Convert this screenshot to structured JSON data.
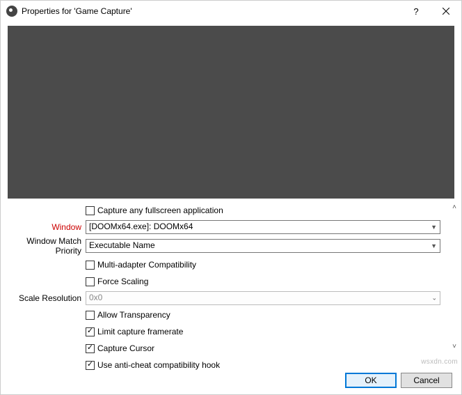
{
  "titlebar": {
    "title": "Properties for 'Game Capture'"
  },
  "form": {
    "capture_fullscreen": {
      "label": "Capture any fullscreen application",
      "checked": false
    },
    "window": {
      "label": "Window",
      "value": "[DOOMx64.exe]: DOOMx64"
    },
    "match_priority": {
      "label": "Window Match Priority",
      "value": "Executable Name"
    },
    "multi_adapter": {
      "label": "Multi-adapter Compatibility",
      "checked": false
    },
    "force_scaling": {
      "label": "Force Scaling",
      "checked": false
    },
    "scale_resolution": {
      "label": "Scale Resolution",
      "value": "0x0"
    },
    "allow_transparency": {
      "label": "Allow Transparency",
      "checked": false
    },
    "limit_framerate": {
      "label": "Limit capture framerate",
      "checked": true
    },
    "capture_cursor": {
      "label": "Capture Cursor",
      "checked": true
    },
    "anti_cheat": {
      "label": "Use anti-cheat compatibility hook",
      "checked": true
    }
  },
  "buttons": {
    "ok": "OK",
    "cancel": "Cancel"
  },
  "watermark": "wsxdn.com"
}
